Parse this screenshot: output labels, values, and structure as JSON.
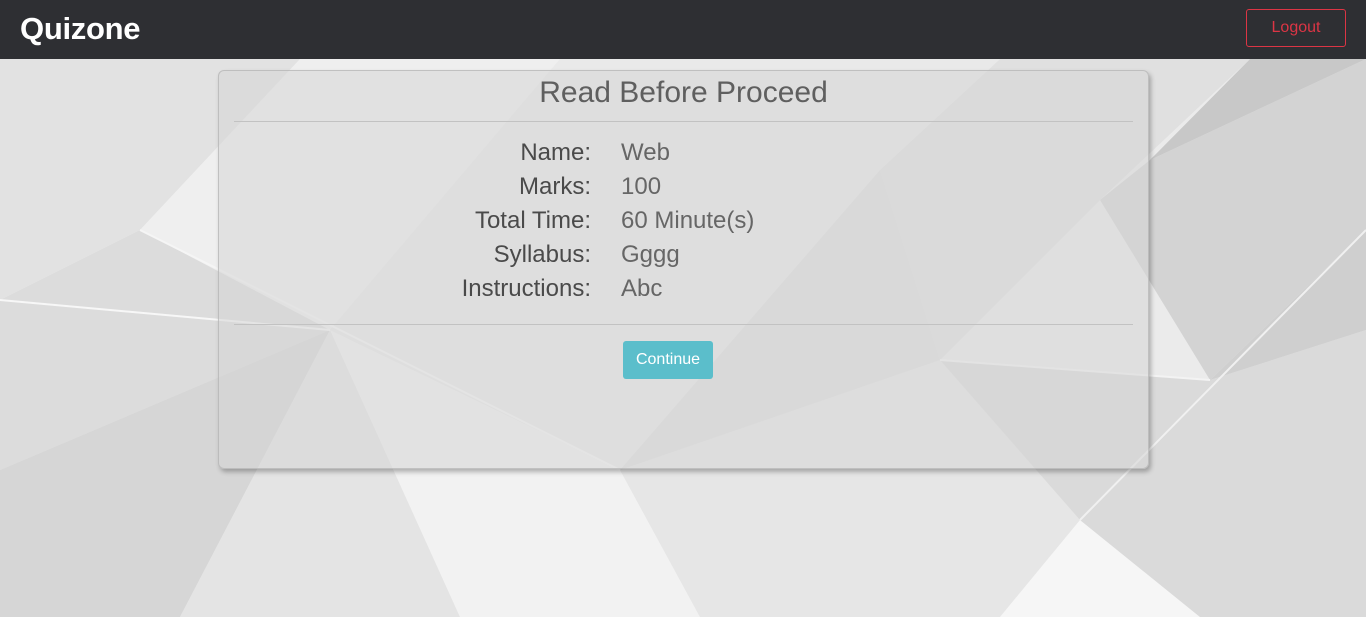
{
  "navbar": {
    "brand": "Quizone",
    "logout_label": "Logout"
  },
  "card": {
    "title": "Read Before Proceed",
    "rows": [
      {
        "label": "Name:",
        "value": "Web"
      },
      {
        "label": "Marks:",
        "value": "100"
      },
      {
        "label": "Total Time:",
        "value": "60 Minute(s)"
      },
      {
        "label": "Syllabus:",
        "value": "Gggg"
      },
      {
        "label": "Instructions:",
        "value": "Abc"
      }
    ],
    "continue_label": "Continue"
  },
  "colors": {
    "navbar_bg": "#2e2f33",
    "logout_accent": "#dc3545",
    "continue_bg": "#5bbecb"
  }
}
